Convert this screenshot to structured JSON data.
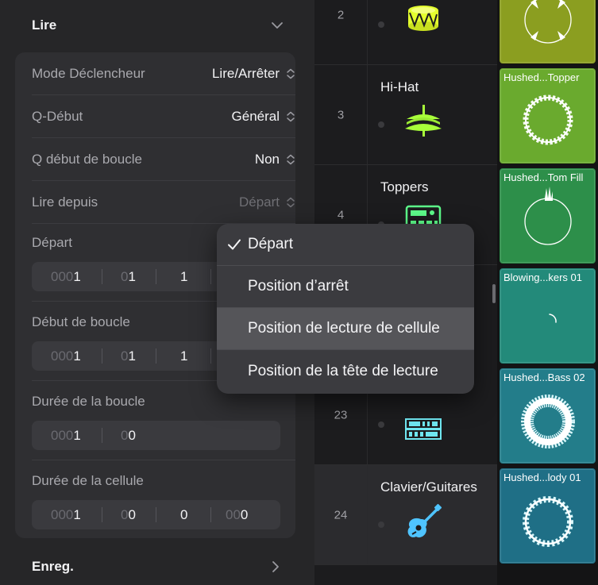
{
  "inspector": {
    "play_section": {
      "title": "Lire"
    },
    "rows": [
      {
        "label": "Mode Déclencheur",
        "value": "Lire/Arrêter"
      },
      {
        "label": "Q-Début",
        "value": "Général"
      },
      {
        "label": "Q début de boucle",
        "value": "Non"
      },
      {
        "label": "Lire depuis",
        "value": "Départ"
      }
    ],
    "start": {
      "label": "Départ",
      "seg1_pre": "000",
      "seg1_num": "1",
      "seg2_pre": "0",
      "seg2_num": "1",
      "seg3_num": "1"
    },
    "loop_start": {
      "label": "Début de boucle",
      "seg1_pre": "000",
      "seg1_num": "1",
      "seg2_pre": "0",
      "seg2_num": "1",
      "seg3_num": "1"
    },
    "loop_length": {
      "label": "Durée de la boucle",
      "seg1_pre": "000",
      "seg1_num": "1",
      "seg2_pre": "0",
      "seg2_num": "0"
    },
    "cell_length": {
      "label": "Durée de la cellule",
      "seg1_pre": "000",
      "seg1_num": "1",
      "seg2_pre": "0",
      "seg2_num": "0",
      "seg3_num": "0",
      "seg4_pre": "00",
      "seg4_num": "0"
    },
    "record_section": {
      "title": "Enreg."
    }
  },
  "menu": {
    "items": [
      {
        "label": "Départ",
        "checked": true
      },
      {
        "label": "Position d’arrêt",
        "checked": false
      },
      {
        "label": "Position de lecture de cellule",
        "checked": false,
        "highlighted": true
      },
      {
        "label": "Position de la tête de lecture",
        "checked": false
      }
    ]
  },
  "tracks": [
    {
      "number": "2",
      "name": "",
      "icon": "snare-drum-icon",
      "color": "#e4ff2e"
    },
    {
      "number": "3",
      "name": "Hi-Hat",
      "icon": "hi-hat-cymbal-icon",
      "color": "#a8ff3a"
    },
    {
      "number": "4",
      "name": "Toppers",
      "icon": "drum-machine-icon",
      "color": "#5dfc8a"
    },
    {
      "number": "23",
      "name": "",
      "icon": "synth-rack-icon",
      "color": "#6fe6f0"
    },
    {
      "number": "24",
      "name": "Clavier/Guitares",
      "icon": "acoustic-guitar-icon",
      "color": "#4fc4ff"
    }
  ],
  "cells": [
    {
      "name": "",
      "color": "#8b9e20"
    },
    {
      "name": "Hushed...Topper",
      "color": "#6aaa2e"
    },
    {
      "name": "Hushed...Tom Fill",
      "color": "#2d8f4a"
    },
    {
      "name": "Blowing...kers 01",
      "color": "#238a7a"
    },
    {
      "name": "Hushed...Bass 02",
      "color": "#237d8a"
    },
    {
      "name": "Hushed...lody 01",
      "color": "#1f6f86"
    }
  ]
}
